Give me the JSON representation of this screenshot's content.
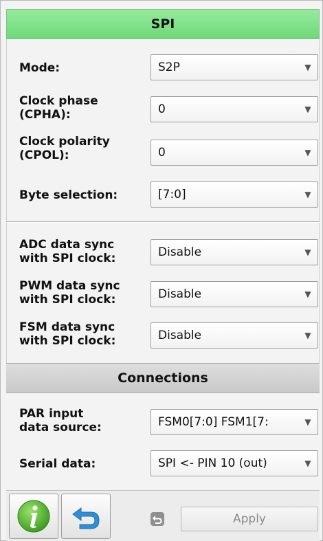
{
  "spi_section": {
    "title": "SPI",
    "rows": [
      {
        "label_lines": [
          "Mode:"
        ],
        "value": "S2P"
      },
      {
        "label_lines": [
          "Clock phase",
          "(CPHA):"
        ],
        "value": "0"
      },
      {
        "label_lines": [
          "Clock polarity",
          "(CPOL):"
        ],
        "value": "0"
      },
      {
        "label_lines": [
          "Byte selection:"
        ],
        "value": "[7:0]"
      }
    ],
    "sync_rows": [
      {
        "label_lines": [
          "ADC data sync",
          "with SPI clock:"
        ],
        "value": "Disable"
      },
      {
        "label_lines": [
          "PWM data sync",
          "with SPI clock:"
        ],
        "value": "Disable"
      },
      {
        "label_lines": [
          "FSM data sync",
          "with SPI clock:"
        ],
        "value": "Disable"
      }
    ]
  },
  "connections_section": {
    "title": "Connections",
    "rows": [
      {
        "label_lines": [
          "PAR input",
          "data source:"
        ],
        "value": "FSM0[7:0] FSM1[7:"
      },
      {
        "label_lines": [
          "Serial data:"
        ],
        "value": "SPI <- PIN 10 (out)"
      }
    ]
  },
  "footer": {
    "info_icon": "info-icon",
    "undo_icon": "undo-icon",
    "apply_label": "Apply"
  },
  "colors": {
    "spi_header": "#6fd97a",
    "connections_header": "#d0d0d0",
    "info_green": "#4cae2a",
    "undo_blue": "#2e8fd6"
  }
}
